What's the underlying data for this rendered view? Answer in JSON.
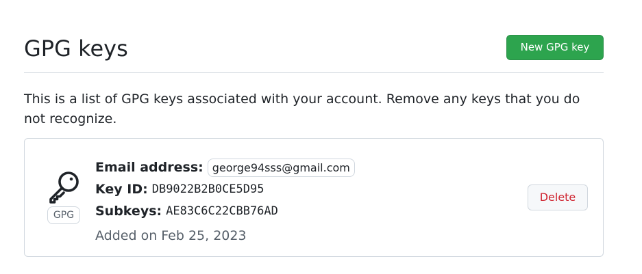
{
  "page": {
    "title": "GPG keys",
    "new_key_button": "New GPG key",
    "description": "This is a list of GPG keys associated with your account. Remove any keys that you do not recognize."
  },
  "key": {
    "badge": "GPG",
    "email_label": "Email address:",
    "email": "george94sss@gmail.com",
    "key_id_label": "Key ID:",
    "key_id": "DB9022B2B0CE5D95",
    "subkeys_label": "Subkeys:",
    "subkeys": "AE83C6C22CBB76AD",
    "added": "Added on Feb 25, 2023",
    "delete_button": "Delete",
    "icon": "key-icon"
  },
  "colors": {
    "primary_button": "#2da44e",
    "danger_text": "#cf222e",
    "border": "#d0d7de",
    "muted_text": "#57606a"
  }
}
